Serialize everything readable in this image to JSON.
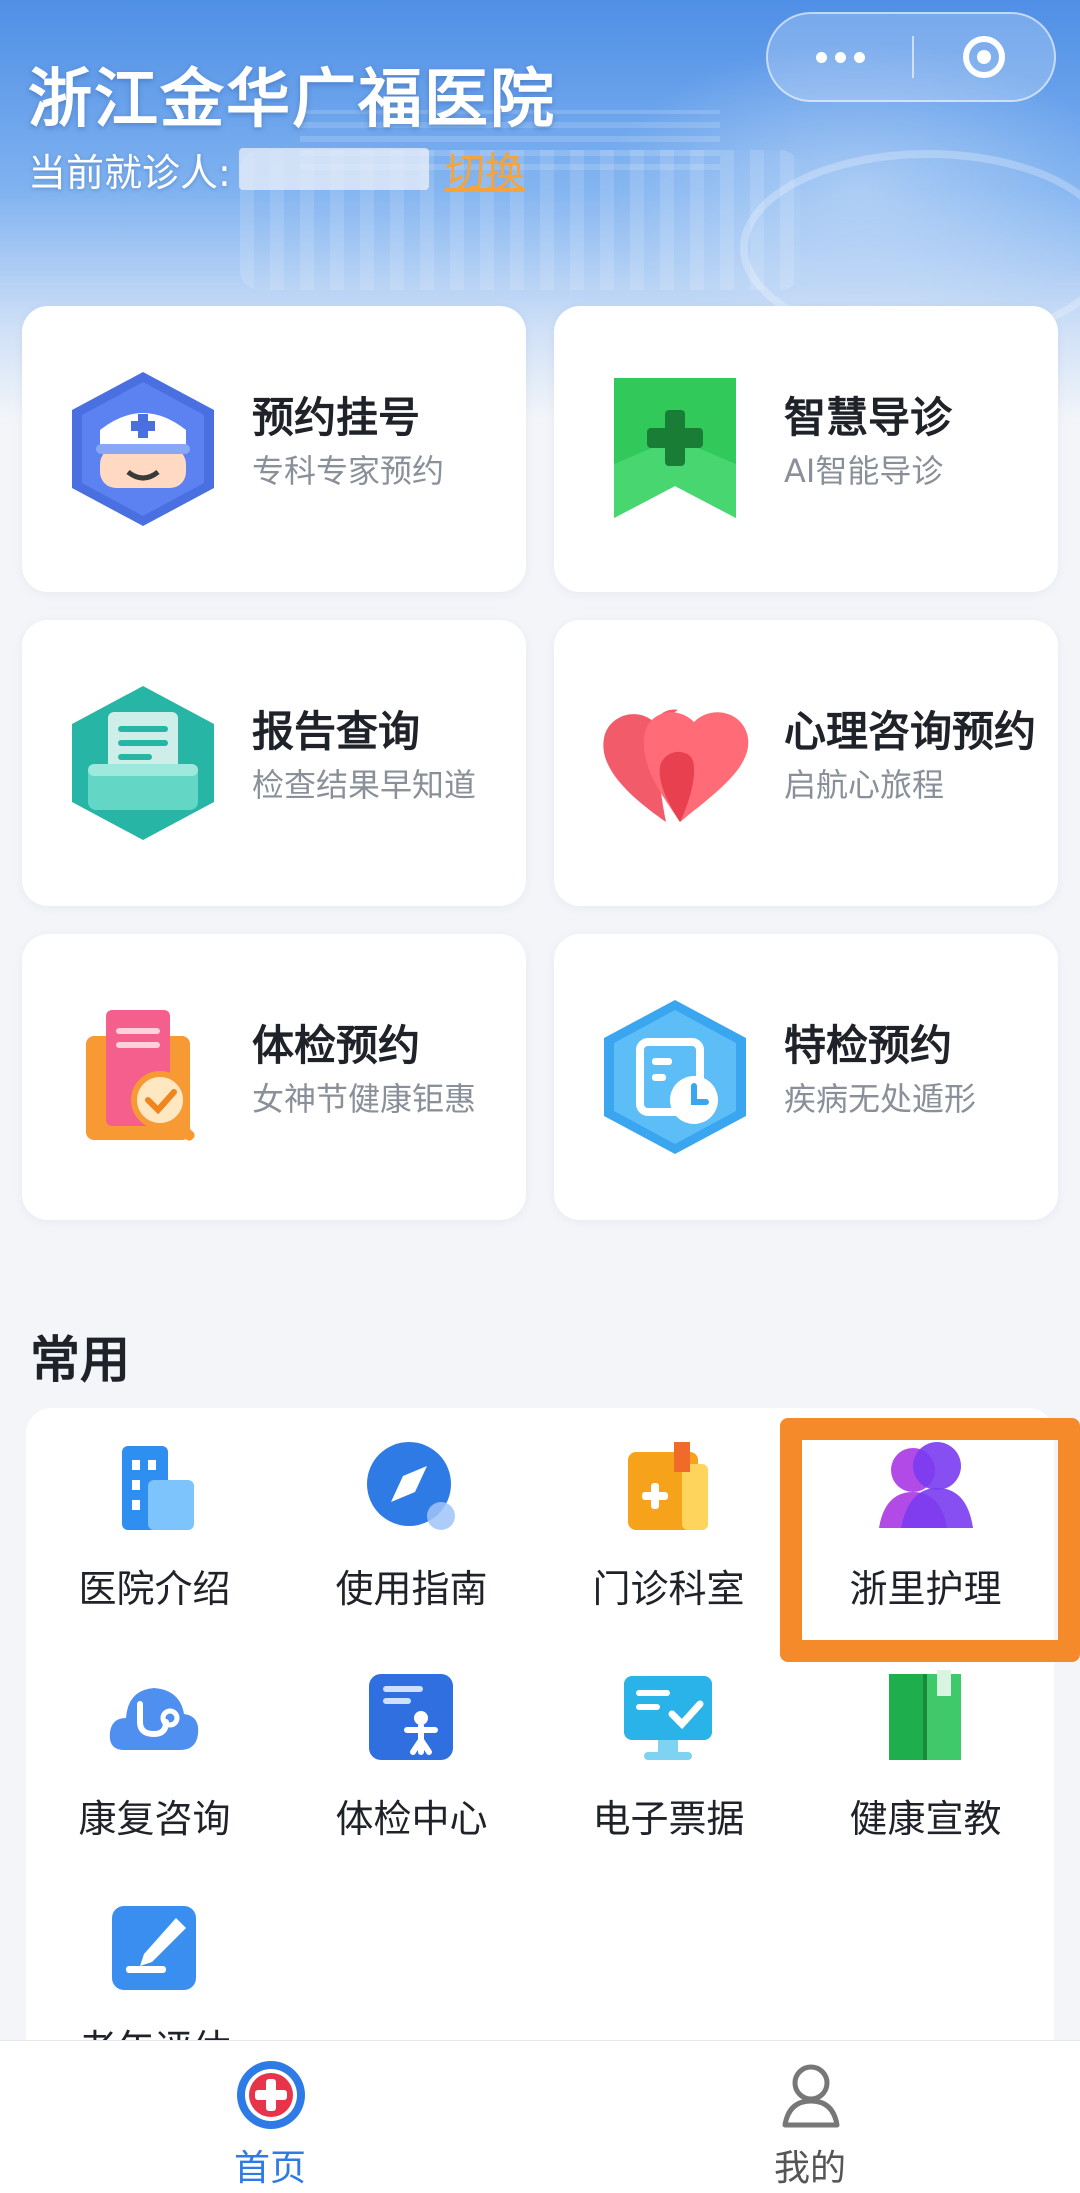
{
  "header": {
    "title": "浙江金华广福医院",
    "patient_label": "当前就诊人:",
    "switch_label": "切换"
  },
  "services": [
    {
      "title": "预约挂号",
      "subtitle": "专科专家预约",
      "icon": "nurse-icon"
    },
    {
      "title": "智慧导诊",
      "subtitle": "AI智能导诊",
      "icon": "medical-bookmark-icon"
    },
    {
      "title": "报告查询",
      "subtitle": "检查结果早知道",
      "icon": "report-printer-icon"
    },
    {
      "title": "心理咨询预约",
      "subtitle": "启航心旅程",
      "icon": "heart-icon"
    },
    {
      "title": "体检预约",
      "subtitle": "女神节健康钜惠",
      "icon": "checkup-document-icon"
    },
    {
      "title": "特检预约",
      "subtitle": "疾病无处遁形",
      "icon": "calendar-clock-icon"
    }
  ],
  "common": {
    "section_title": "常用",
    "items": [
      {
        "label": "医院介绍",
        "icon": "building-icon"
      },
      {
        "label": "使用指南",
        "icon": "compass-icon"
      },
      {
        "label": "门诊科室",
        "icon": "clinic-folder-icon"
      },
      {
        "label": "浙里护理",
        "icon": "nursing-people-icon"
      },
      {
        "label": "康复咨询",
        "icon": "stethoscope-cloud-icon"
      },
      {
        "label": "体检中心",
        "icon": "person-document-icon"
      },
      {
        "label": "电子票据",
        "icon": "monitor-check-icon"
      },
      {
        "label": "健康宣教",
        "icon": "book-icon"
      },
      {
        "label": "老年评估",
        "icon": "edit-pencil-icon"
      }
    ]
  },
  "nav": {
    "home_label": "首页",
    "mine_label": "我的"
  },
  "colors": {
    "accent": "#2f7be5",
    "highlight": "#f58a2a",
    "nav_active": "#2f7be5",
    "nav_inactive": "#666666"
  }
}
